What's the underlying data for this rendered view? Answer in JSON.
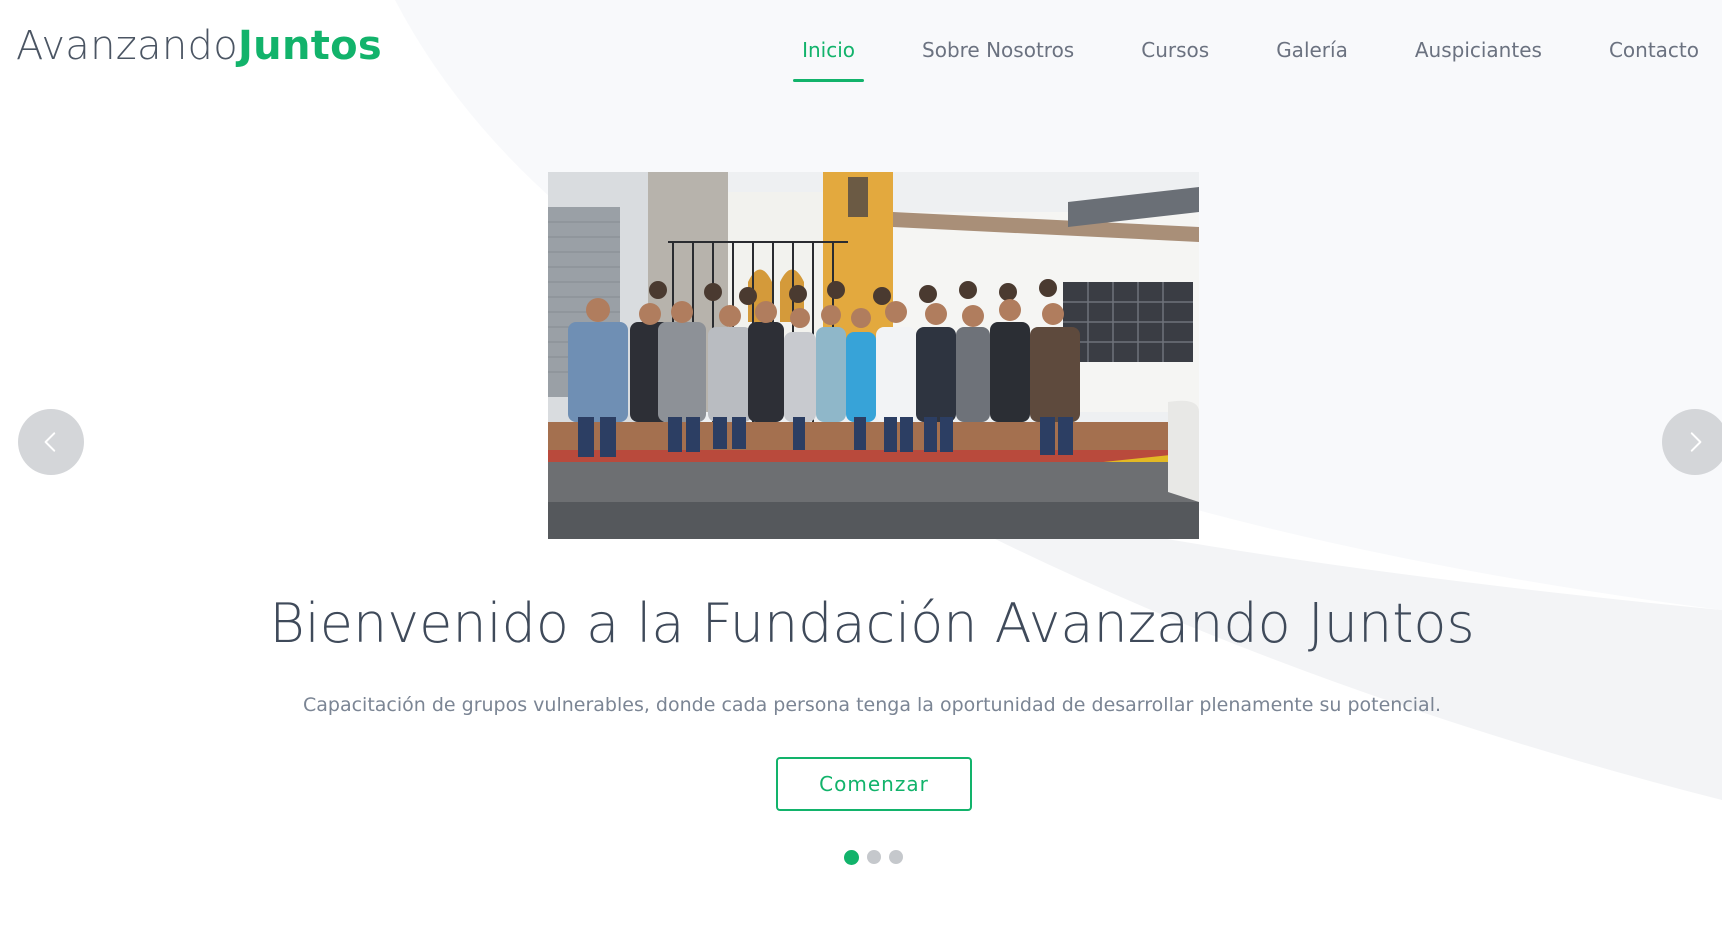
{
  "brand": {
    "part1": "Avanzando",
    "part2": "Juntos",
    "accent_color": "#12b36b"
  },
  "nav": {
    "items": [
      {
        "label": "Inicio",
        "active": true
      },
      {
        "label": "Sobre Nosotros",
        "active": false
      },
      {
        "label": "Cursos",
        "active": false
      },
      {
        "label": "Galería",
        "active": false
      },
      {
        "label": "Auspiciantes",
        "active": false
      },
      {
        "label": "Contacto",
        "active": false
      }
    ]
  },
  "hero": {
    "title": "Bienvenido a la Fundación Avanzando Juntos",
    "subtitle": "Capacitación de grupos vulnerables, donde cada persona tenga la oportunidad de desarrollar plenamente su potencial.",
    "cta_label": "Comenzar",
    "prev_icon": "chevron-left-icon",
    "next_icon": "chevron-right-icon"
  },
  "carousel": {
    "slide_count": 3,
    "active_index": 0
  }
}
